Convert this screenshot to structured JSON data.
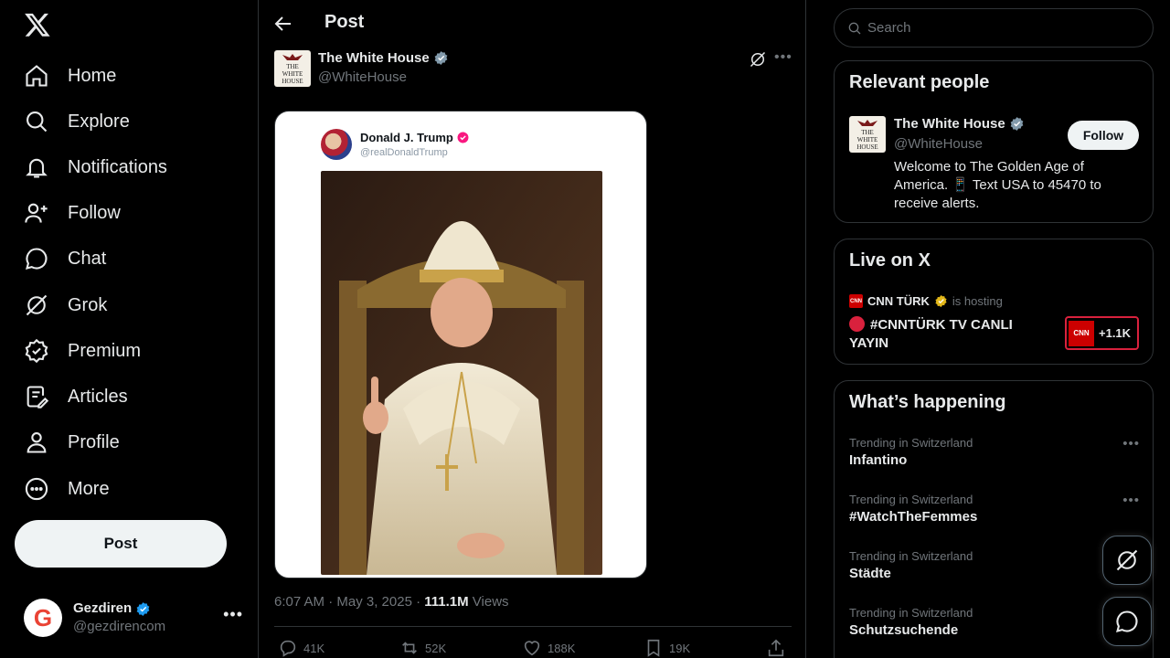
{
  "nav": {
    "items": [
      {
        "label": "Home",
        "icon": "home-icon"
      },
      {
        "label": "Explore",
        "icon": "search-icon"
      },
      {
        "label": "Notifications",
        "icon": "bell-icon"
      },
      {
        "label": "Follow",
        "icon": "person-add-icon"
      },
      {
        "label": "Chat",
        "icon": "chat-icon"
      },
      {
        "label": "Grok",
        "icon": "grok-icon"
      },
      {
        "label": "Premium",
        "icon": "premium-icon"
      },
      {
        "label": "Articles",
        "icon": "articles-icon"
      },
      {
        "label": "Profile",
        "icon": "person-icon"
      },
      {
        "label": "More",
        "icon": "more-circle-icon"
      }
    ],
    "post_label": "Post"
  },
  "account": {
    "name": "Gezdiren",
    "handle": "@gezdirencom",
    "avatar_letter": "G"
  },
  "header": {
    "title": "Post"
  },
  "post": {
    "author_name": "The White House",
    "author_handle": "@WhiteHouse",
    "avatar_text": [
      "THE",
      "WHITE",
      "HOUSE"
    ],
    "embedded": {
      "name": "Donald J. Trump",
      "handle": "@realDonaldTrump"
    },
    "time": "6:07 AM · May 3, 2025 · ",
    "views_count": "111.1M",
    "views_label": " Views",
    "stats": {
      "replies": "41K",
      "reposts": "52K",
      "likes": "188K",
      "bookmarks": "19K"
    }
  },
  "search": {
    "placeholder": "Search"
  },
  "relevant": {
    "title": "Relevant people",
    "name": "The White House",
    "handle": "@WhiteHouse",
    "bio": "Welcome to The Golden Age of America. 📱 Text USA to 45470 to receive alerts.",
    "follow_label": "Follow"
  },
  "live": {
    "title": "Live on X",
    "host": "CNN TÜRK",
    "host_suffix": "is hosting",
    "logo_text": "CNN",
    "show": "#CNNTÜRK TV CANLI YAYIN",
    "count": "+1.1K"
  },
  "happening": {
    "title": "What’s happening",
    "trends": [
      {
        "context": "Trending in Switzerland",
        "topic": "Infantino"
      },
      {
        "context": "Trending in Switzerland",
        "topic": "#WatchTheFemmes"
      },
      {
        "context": "Trending in Switzerland",
        "topic": "Städte"
      },
      {
        "context": "Trending in Switzerland",
        "topic": "Schutzsuchende"
      }
    ]
  },
  "colors": {
    "background": "#000000",
    "border": "#2f3336",
    "verified_blue": "#1d9bf0",
    "verified_gold": "#e2b719",
    "muted": "#71767b"
  }
}
